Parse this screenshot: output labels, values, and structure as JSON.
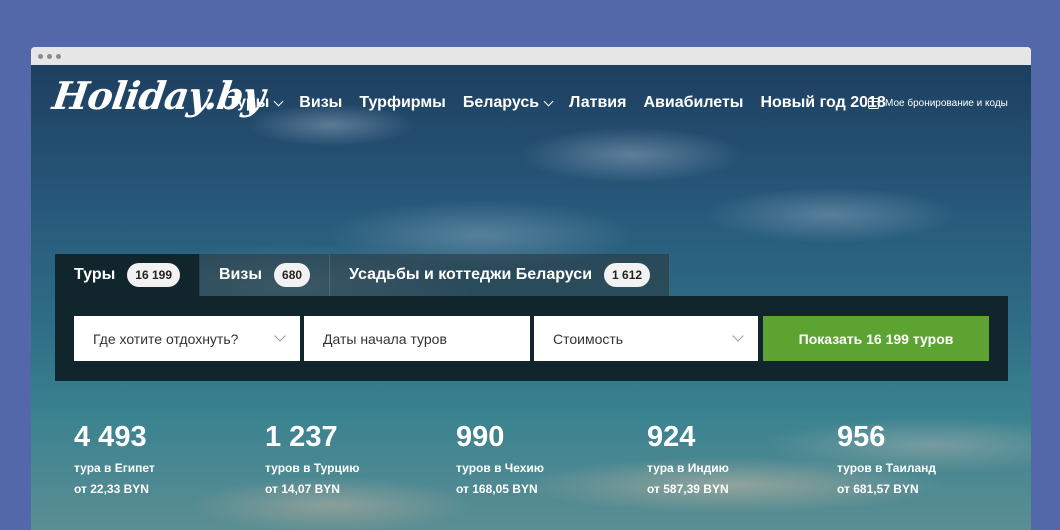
{
  "logo": "Holiday.by",
  "nav": [
    {
      "label": "Туры",
      "dropdown": true
    },
    {
      "label": "Визы",
      "dropdown": false
    },
    {
      "label": "Турфирмы",
      "dropdown": false
    },
    {
      "label": "Беларусь",
      "dropdown": true
    },
    {
      "label": "Латвия",
      "dropdown": false
    },
    {
      "label": "Авиабилеты",
      "dropdown": false
    },
    {
      "label": "Новый год 2018",
      "dropdown": false
    }
  ],
  "booking": {
    "label": "Мое бронирование и коды",
    "icon": "calendar-icon"
  },
  "search": {
    "tabs": [
      {
        "label": "Туры",
        "count": "16 199",
        "active": true
      },
      {
        "label": "Визы",
        "count": "680",
        "active": false
      },
      {
        "label": "Усадьбы и коттеджи Беларуси",
        "count": "1 612",
        "active": false
      }
    ],
    "destination_placeholder": "Где хотите отдохнуть?",
    "dates_placeholder": "Даты начала туров",
    "price_placeholder": "Стоимость",
    "submit_label": "Показать 16 199 туров"
  },
  "stats": [
    {
      "number": "4 493",
      "label": "тура в Египет",
      "price": "от 22,33 BYN"
    },
    {
      "number": "1 237",
      "label": "туров в Турцию",
      "price": "от 14,07 BYN"
    },
    {
      "number": "990",
      "label": "туров в Чехию",
      "price": "от 168,05 BYN"
    },
    {
      "number": "924",
      "label": "тура в Индию",
      "price": "от 587,39 BYN"
    },
    {
      "number": "956",
      "label": "туров в Таиланд",
      "price": "от 681,57 BYN"
    }
  ],
  "colors": {
    "accent": "#5da331",
    "panel": "#10252c",
    "background": "#5268a8"
  }
}
